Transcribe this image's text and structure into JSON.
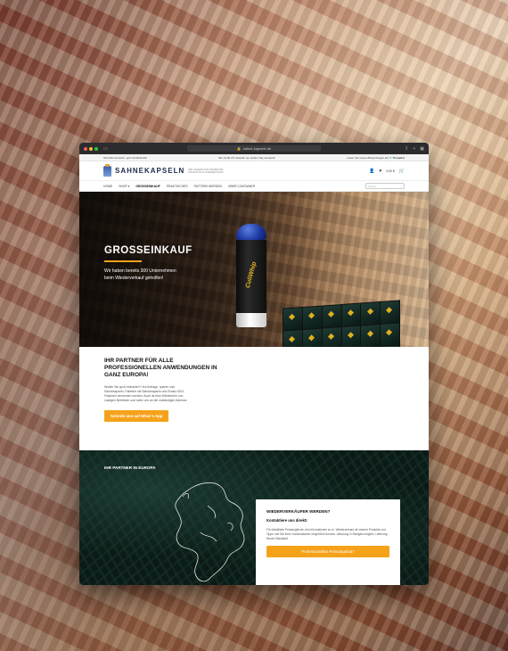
{
  "browser": {
    "url": "sahne-kapseln.de",
    "traffic_lights": [
      "#ff5f57",
      "#febc2e",
      "#28c840"
    ]
  },
  "topbar": {
    "left": "Schnelle Versand - jetzt Großhandel!",
    "center": "Bei 14.00 Uhr bestellt: am selben Tag versandt!",
    "right": "Lesen Sie unsere Bewertungen auf",
    "trustpilot": "Trustpilot"
  },
  "header": {
    "logo_text": "SAHNEKAPSELN",
    "logo_tagline": "WIR LIEFERN NUR DIE BESTEN PRODUKTE IN UNSEREM SHOP",
    "cart_label": "0,00 €"
  },
  "nav": {
    "items": [
      "HOME",
      "SHOP",
      "GROSSEINKAUF",
      "PRAKTISCHES",
      "PATTERN WERDEN",
      "ÜBER",
      "CONTAINER"
    ],
    "active_index": 2,
    "search_placeholder": "Suche..."
  },
  "hero": {
    "title": "GROSSEINKAUF",
    "subtitle": "Wir haben bereits 300 Unternehmen beim Wiederverkauf geholfen!",
    "capsule_label": "CuliWhip"
  },
  "partner": {
    "title": "IHR PARTNER FÜR ALLE PROFESSIONELLEN ANWENDUNGEN IN GANZ EUROPA!",
    "body": "Wollen Sie groß einkaufen? Auf Anfrage, sparen sich Sahnekapseln, Paletten mit Sahnekapseln und Ersatz-N2O-Flaschen versenden werden. Auch ist eine Wiederkehr von Lastigen Betrieben und mehr uns an die zuständigen Adresse.",
    "button": "Schreib uns auf What´s App"
  },
  "europe": {
    "title": "IHR PARTNER IN EUROPA",
    "card": {
      "title": "WIEDERVERKÄUFER WERDEN?",
      "subtitle": "Kontaktiere uns direkt!",
      "body": "Für detaillierte Preisangebote, ein Informationen zu m. Wiederverkauf all unserer Produkte und Tipps: wie Sie Ihren Kundenstamm vergrößern können. Abholung in Stuttgart möglich, Lieferung: Neuen Standard!",
      "button": "Professionelles Preisangebot?"
    }
  },
  "colors": {
    "accent": "#f5a21b",
    "header_dark": "#1c2a4a"
  }
}
